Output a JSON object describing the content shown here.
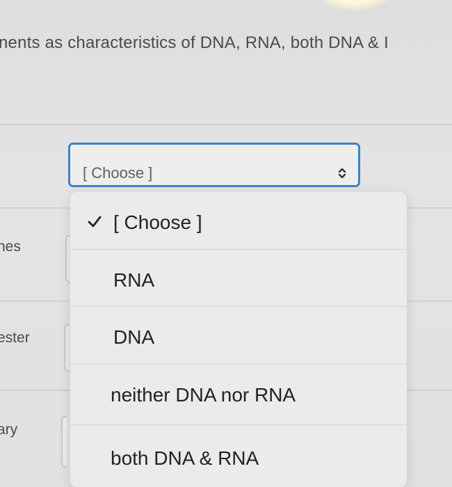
{
  "instructions": "nents as characteristics of DNA, RNA, both DNA & I",
  "rows": [
    {
      "label": "nes"
    },
    {
      "label": "ester"
    },
    {
      "label": "ary"
    }
  ],
  "select": {
    "value": "[ Choose ]",
    "icon": "up-down-chevron-icon",
    "accent": "#3f82c6"
  },
  "dropdown": {
    "options": [
      {
        "label": "[ Choose ]",
        "selected": true
      },
      {
        "label": "RNA",
        "selected": false
      },
      {
        "label": "DNA",
        "selected": false
      },
      {
        "label": "neither DNA nor RNA",
        "selected": false
      },
      {
        "label": "both DNA & RNA",
        "selected": false
      }
    ],
    "check_icon": "checkmark-icon"
  }
}
